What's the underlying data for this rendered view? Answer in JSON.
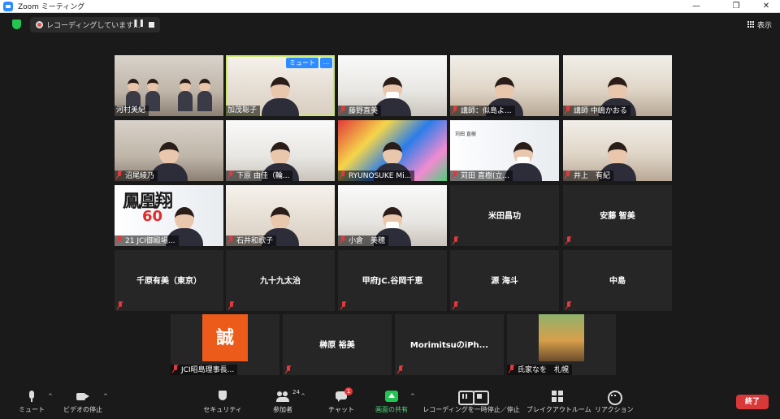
{
  "window": {
    "title": "Zoom ミーティング",
    "minimize": "—",
    "maximize": "❐",
    "close": "✕"
  },
  "topbar": {
    "recording_text": "レコーディングしています...",
    "pause_glyph": "❚❚",
    "view_label": "表示"
  },
  "tiles": {
    "t1": "河村美紀",
    "t2": "加茂聡子",
    "t2_mute_label": "ミュート",
    "t2_more": "...",
    "t3": "藤野直美",
    "t4": "講師：似島よ...",
    "t5": "講師 中嶋かおる",
    "t6": "沼尾綾乃",
    "t7": "下原 由佳（輪...",
    "t8": "RYUNOSUKE Mi...",
    "t9": "苅田 直樹(立...",
    "t9_card": "苅田 直樹",
    "t10": "井上　有紀",
    "t11": "21 JCI御殿場...",
    "t11_brush": "鳳凰翔",
    "t11_num": "60",
    "t12": "石井和歌子",
    "t13": "小倉　美穂",
    "t14": "米田昌功",
    "t15": "安藤 智美",
    "t16": "千原有美（東京）",
    "t17": "九十九太治",
    "t18": "甲府JC.谷岡千恵",
    "t19": "源 海斗",
    "t20": "中島",
    "t21": "JCI昭島理事長...",
    "t21_block": "誠",
    "t22": "榊原 裕美",
    "t23": "MorimitsuのiPh...",
    "t24": "氏家なを　札幌"
  },
  "toolbar": {
    "mute": "ミュート",
    "video": "ビデオの停止",
    "security": "セキュリティ",
    "participants": "参加者",
    "participants_count": "24",
    "chat": "チャット",
    "chat_badge": "1",
    "share": "画面の共有",
    "record": "レコーディングを一時停止／停止",
    "breakout": "ブレイクアウトルーム",
    "reactions": "リアクション",
    "end": "終了",
    "caret": "^"
  },
  "colors": {
    "accent_blue": "#2d8cff",
    "share_green": "#23c552",
    "end_red": "#d93838",
    "active_speaker": "#c9e86d",
    "muted_red": "#e5383b"
  },
  "icons": [
    "zoom-app-icon",
    "security-shield-icon",
    "recording-dot-icon",
    "grid-view-icon",
    "microphone-icon",
    "video-camera-icon",
    "security-icon",
    "participants-icon",
    "chat-icon",
    "share-screen-icon",
    "record-pause-icon",
    "record-stop-icon",
    "breakout-rooms-icon",
    "reactions-icon",
    "muted-mic-icon"
  ]
}
